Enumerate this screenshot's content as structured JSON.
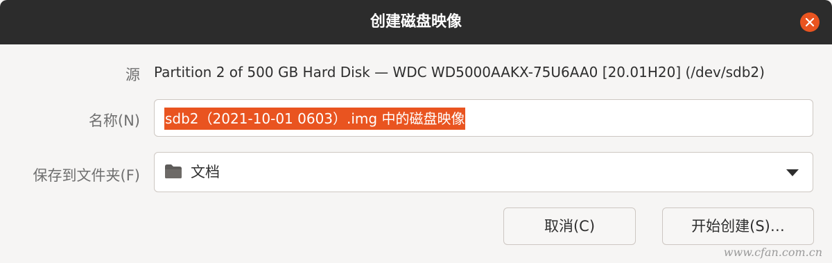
{
  "window": {
    "title": "创建磁盘映像"
  },
  "form": {
    "source_label": "源",
    "source_value": "Partition 2 of 500 GB Hard Disk — WDC WD5000AAKX-75U6AA0 [20.01H20] (/dev/sdb2)",
    "name_label": "名称(N)",
    "name_value": "sdb2（2021-10-01 0603）.img 中的磁盘映像",
    "folder_label": "保存到文件夹(F)",
    "folder_value": "文档"
  },
  "buttons": {
    "cancel": "取消(C)",
    "start": "开始创建(S)…"
  },
  "watermark": "www.cfan.com.cn",
  "colors": {
    "titlebar": "#2c2c2c",
    "accent": "#e95420",
    "background": "#f6f5f4"
  },
  "icons": {
    "close": "close-icon",
    "folder": "folder-icon",
    "dropdown": "chevron-down-icon"
  }
}
